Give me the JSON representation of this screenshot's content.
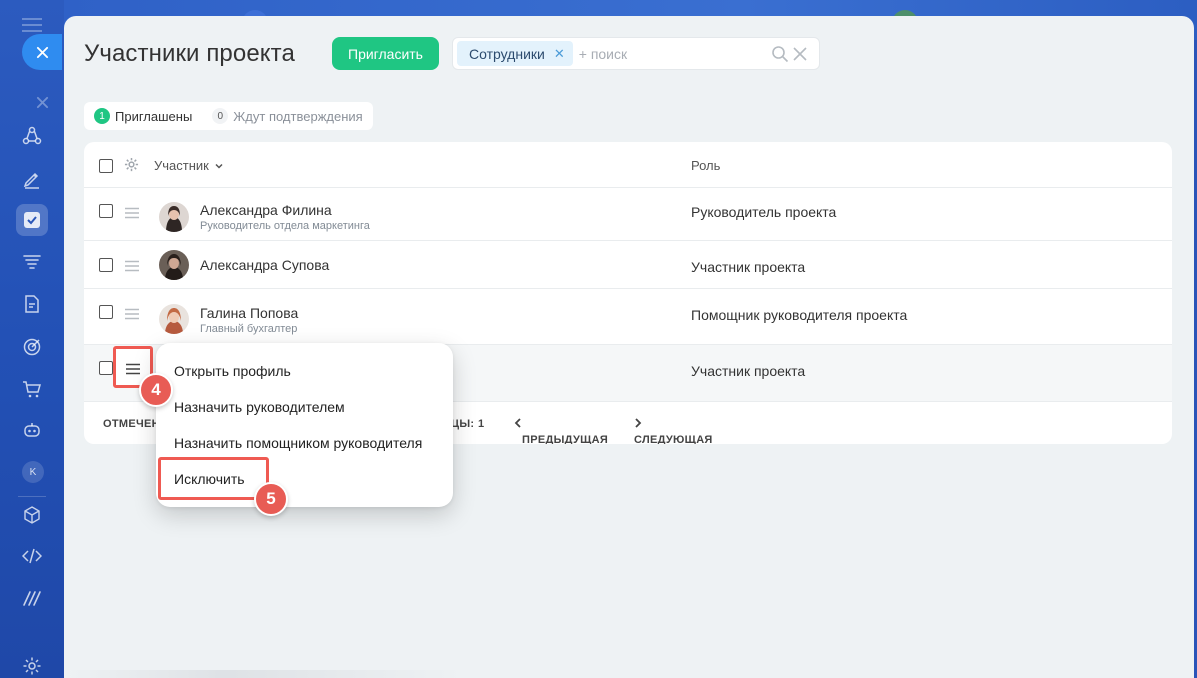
{
  "header": {
    "title": "Участники проекта",
    "invite_label": "Пригласить",
    "search": {
      "chip_label": "Сотрудники",
      "placeholder": "+ поиск"
    }
  },
  "tabs": [
    {
      "count": "1",
      "label": "Приглашены"
    },
    {
      "count": "0",
      "label": "Ждут подтверждения"
    }
  ],
  "table": {
    "columns": {
      "member": "Участник",
      "role": "Роль"
    },
    "rows": [
      {
        "name": "Александра Филина",
        "position": "Руководитель отдела маркетинга",
        "role": "Руководитель проекта"
      },
      {
        "name": "Александра Супова",
        "position": "",
        "role": "Участник проекта"
      },
      {
        "name": "Галина Попова",
        "position": "Главный бухгалтер",
        "role": "Помощник руководителя проекта"
      },
      {
        "name": "",
        "position": "",
        "role": "Участник проекта"
      }
    ],
    "footer": {
      "selected_label": "ОТМЕЧЕН",
      "page_label": "ЦЫ:",
      "page_value": "1",
      "prev_label": "ПРЕДЫДУЩАЯ",
      "next_label": "СЛЕДУЮЩАЯ"
    }
  },
  "context_menu": {
    "items": [
      "Открыть профиль",
      "Назначить руководителем",
      "Назначить помощником руководителя",
      "Исключить"
    ]
  },
  "sidebar": {
    "avatar_letter": "K"
  },
  "annotations": {
    "step_menu": "4",
    "step_exclude": "5"
  },
  "colors": {
    "accent_green": "#1fc683",
    "highlight_red": "#ef5a52",
    "sidebar_blue": "#2351b6"
  }
}
